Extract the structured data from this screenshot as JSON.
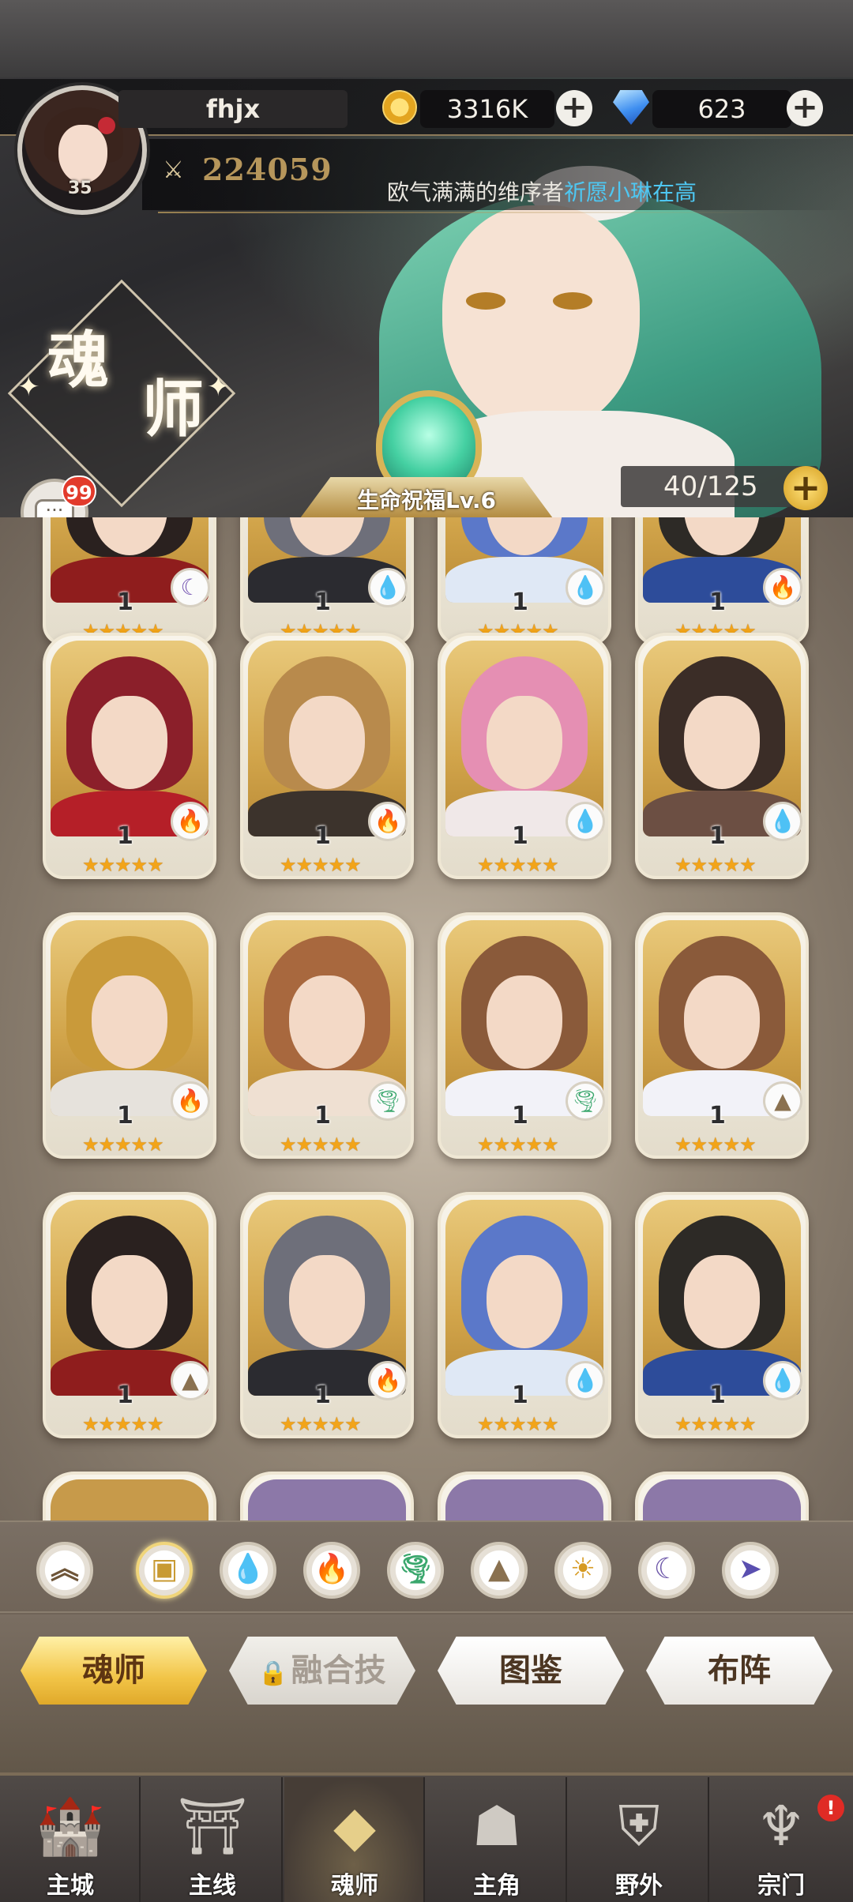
{
  "player": {
    "name": "fhjx",
    "level": "35",
    "power": "224059"
  },
  "resources": {
    "gold": "3316K",
    "gems": "623"
  },
  "marquee": {
    "prefix": "欧气满满的维序者",
    "highlight": "祈愿小琳",
    "suffix": "在高"
  },
  "page": {
    "title_char_1": "魂",
    "title_char_2": "师"
  },
  "blessing": {
    "label": "生命祝福Lv.6"
  },
  "capacity": {
    "text": "40/125"
  },
  "chat": {
    "badge": "99"
  },
  "heroes": {
    "row0": [
      {
        "level": "1",
        "element": "dark",
        "stars": "★★★★★"
      },
      {
        "level": "1",
        "element": "water",
        "stars": "★★★★★"
      },
      {
        "level": "1",
        "element": "water",
        "stars": "★★★★★"
      },
      {
        "level": "1",
        "element": "fire",
        "stars": "★★★★★"
      }
    ],
    "row1": [
      {
        "level": "1",
        "element": "fire",
        "stars": "★★★★★"
      },
      {
        "level": "1",
        "element": "fire",
        "stars": "★★★★★"
      },
      {
        "level": "1",
        "element": "water",
        "stars": "★★★★★"
      },
      {
        "level": "1",
        "element": "water",
        "stars": "★★★★★"
      }
    ],
    "row2": [
      {
        "level": "1",
        "element": "fire",
        "stars": "★★★★★"
      },
      {
        "level": "1",
        "element": "wind",
        "stars": "★★★★★"
      },
      {
        "level": "1",
        "element": "wind",
        "stars": "★★★★★"
      },
      {
        "level": "1",
        "element": "earth",
        "stars": "★★★★★"
      }
    ],
    "row3": [
      {
        "level": "1",
        "element": "earth",
        "stars": "★★★★★"
      },
      {
        "level": "1",
        "element": "fire",
        "stars": "★★★★★"
      },
      {
        "level": "1",
        "element": "water",
        "stars": "★★★★★"
      },
      {
        "level": "1",
        "element": "water",
        "stars": "★★★★★"
      }
    ]
  },
  "filters": [
    {
      "icon": "rank-chevron-icon"
    },
    {
      "icon": "all-box-icon",
      "active": true
    },
    {
      "icon": "water-icon"
    },
    {
      "icon": "fire-icon"
    },
    {
      "icon": "wind-icon"
    },
    {
      "icon": "earth-icon"
    },
    {
      "icon": "light-icon"
    },
    {
      "icon": "dark-icon"
    },
    {
      "icon": "void-icon"
    }
  ],
  "tabs": {
    "hunshi": "魂师",
    "fusion": "融合技",
    "atlas": "图鉴",
    "formation": "布阵"
  },
  "nav": {
    "main_city": "主城",
    "main_line": "主线",
    "hunshi": "魂师",
    "hero": "主角",
    "wild": "野外",
    "sect": "宗门",
    "sect_badge": "!"
  }
}
